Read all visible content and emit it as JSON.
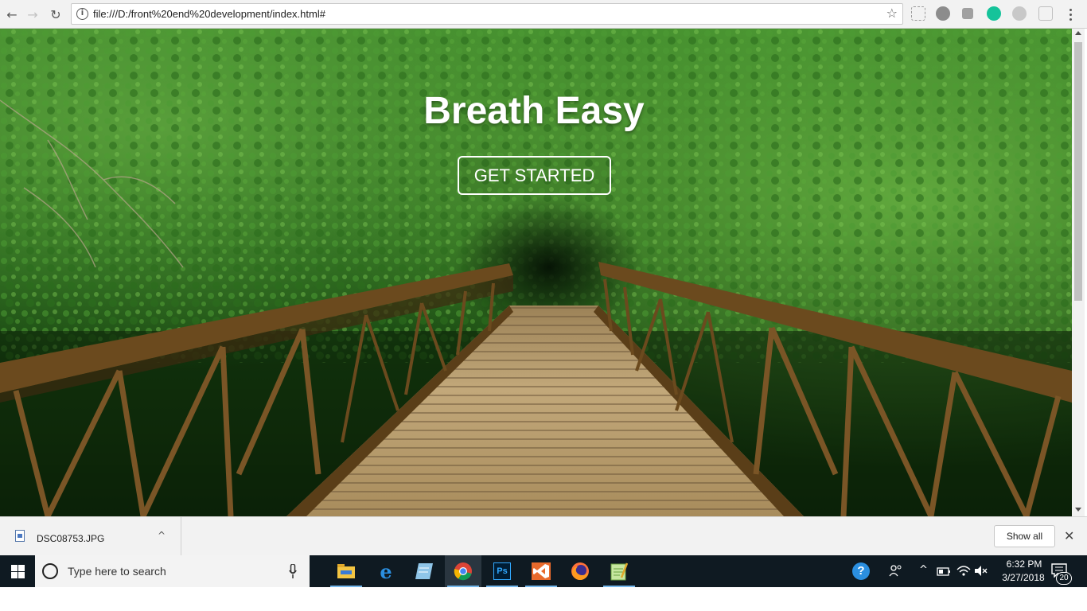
{
  "browser": {
    "url": "file:///D:/front%20end%20development/index.html#",
    "nav": {
      "back_icon": "←",
      "forward_icon": "→",
      "reload_icon": "↻"
    },
    "star_icon": "☆"
  },
  "page": {
    "hero_title": "Breath Easy",
    "cta_label": "GET STARTED"
  },
  "download_bar": {
    "file_name": "DSC08753.JPG",
    "caret": "^",
    "show_all_label": "Show all",
    "close_icon": "✕"
  },
  "taskbar": {
    "search_placeholder": "Type here to search",
    "apps": [
      "file-explorer",
      "edge",
      "notepad-app",
      "chrome",
      "photoshop",
      "visual-studio",
      "firefox",
      "notepad-plus"
    ],
    "active_app": "chrome",
    "tray": {
      "up_arrow": "^",
      "mute_icon": "🔇"
    },
    "clock_time": "6:32 PM",
    "clock_date": "3/27/2018",
    "notification_count": "20"
  },
  "colors": {
    "toolbar_bg": "#f2f2f2",
    "taskbar_bg": "#0f1a22",
    "forest_dark": "#0f2a0c",
    "forest_green": "#2f7a1f",
    "bridge_wood": "#b89a6a",
    "rail_rust": "#6b4a1e"
  }
}
